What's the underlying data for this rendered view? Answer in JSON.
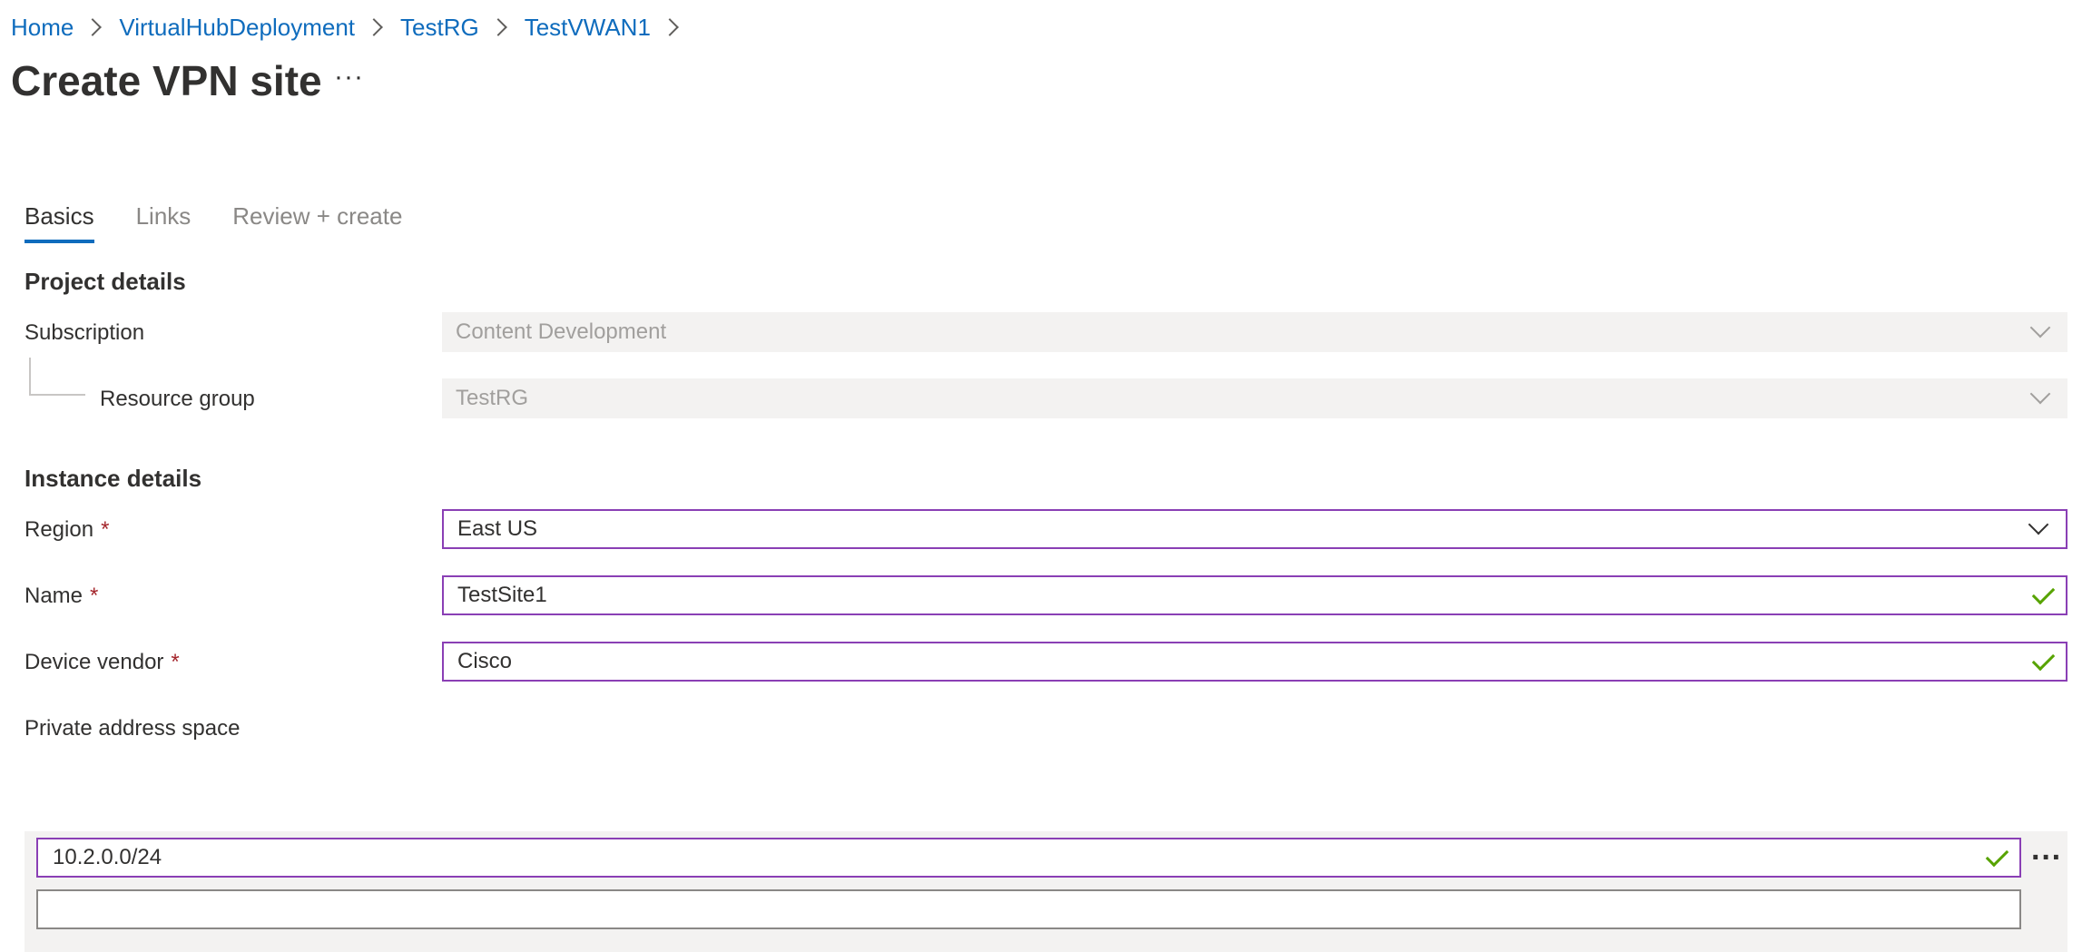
{
  "breadcrumb": {
    "items": [
      "Home",
      "VirtualHubDeployment",
      "TestRG",
      "TestVWAN1"
    ]
  },
  "page": {
    "title": "Create VPN site",
    "more_label": "···"
  },
  "tabs": [
    {
      "label": "Basics",
      "active": true
    },
    {
      "label": "Links",
      "active": false
    },
    {
      "label": "Review + create",
      "active": false
    }
  ],
  "project_details": {
    "heading": "Project details",
    "subscription": {
      "label": "Subscription",
      "value": "Content Development"
    },
    "resource_group": {
      "label": "Resource group",
      "value": "TestRG"
    }
  },
  "instance_details": {
    "heading": "Instance details",
    "region": {
      "label": "Region",
      "required": "*",
      "value": "East US"
    },
    "name": {
      "label": "Name",
      "required": "*",
      "value": "TestSite1"
    },
    "device_vendor": {
      "label": "Device vendor",
      "required": "*",
      "value": "Cisco"
    },
    "private_address_space": {
      "label": "Private address space",
      "entries": [
        "10.2.0.0/24",
        ""
      ],
      "row_more_label": "···"
    }
  },
  "colors": {
    "link": "#0f6cbd",
    "active_border": "#8a3fb5",
    "success": "#57a300",
    "required": "#a4262c",
    "disabled_bg": "#f3f2f1"
  }
}
